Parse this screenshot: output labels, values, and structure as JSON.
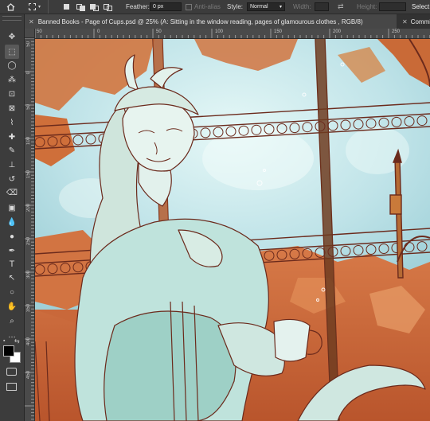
{
  "options_bar": {
    "feather_label": "Feather:",
    "feather_value": "0 px",
    "anti_alias_label": "Anti-alias",
    "style_label": "Style:",
    "style_value": "Normal",
    "width_label": "Width:",
    "height_label": "Height:",
    "select_label": "Select"
  },
  "tabs": [
    {
      "label": "Banned Books - Page of Cups.psd @ 25% (A: Sitting in the window reading, pages of  glamourous clothes , RGB/8)",
      "active": true
    },
    {
      "label": "Commiss",
      "active": false
    }
  ],
  "rulers": {
    "top": [
      "50",
      "0",
      "50",
      "100",
      "150",
      "200",
      "250"
    ],
    "left": [
      "50",
      "0",
      "50",
      "100",
      "150",
      "200",
      "250",
      "300",
      "350",
      "400",
      "450"
    ]
  },
  "tools": [
    "move-tool",
    "marquee-tool",
    "lasso-tool",
    "magic-wand-tool",
    "crop-tool",
    "frame-tool",
    "eyedropper-tool",
    "healing-brush-tool",
    "brush-tool",
    "clone-stamp-tool",
    "history-brush-tool",
    "eraser-tool",
    "gradient-tool",
    "blur-tool",
    "dodge-tool",
    "pen-tool",
    "type-tool",
    "path-selection-tool",
    "ellipse-tool",
    "hand-tool",
    "zoom-tool",
    "more-tools",
    "default-colors",
    "swap-colors",
    "foreground-color",
    "background-color",
    "quick-mask",
    "screen-mode"
  ],
  "colors": {
    "foreground": "#000000",
    "background": "#ffffff",
    "sky": "#bfe6ea",
    "copper": "#c9683a",
    "line": "#6b2a1c"
  }
}
